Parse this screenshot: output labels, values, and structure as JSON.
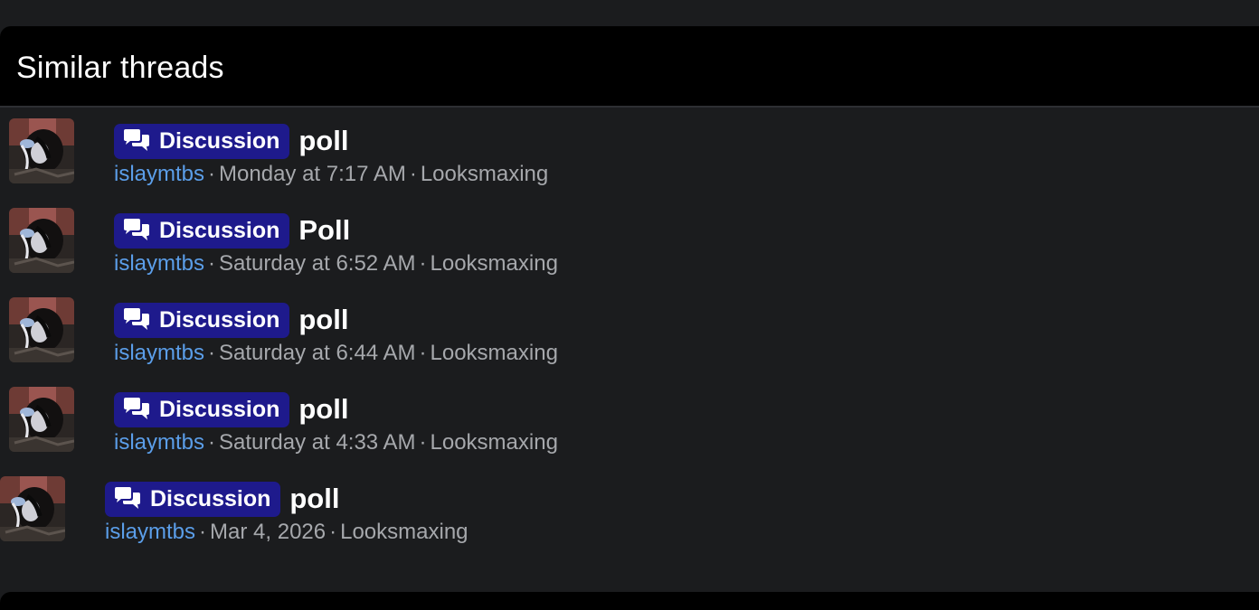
{
  "section": {
    "title": "Similar threads"
  },
  "icons": {
    "badge_icon": "speech-bubbles-icon",
    "avatar": "user-avatar"
  },
  "colors": {
    "background": "#1b1c1e",
    "header_background": "#000000",
    "badge_background": "#1e1a8c",
    "author_link": "#5b9ee9",
    "meta_text": "#a6a8ac",
    "title_text": "#ffffff"
  },
  "threads": [
    {
      "prefix": "Discussion",
      "title": "poll",
      "author": "islaymtbs",
      "date": "Monday at 7:17 AM",
      "forum": "Looksmaxing"
    },
    {
      "prefix": "Discussion",
      "title": "Poll",
      "author": "islaymtbs",
      "date": "Saturday at 6:52 AM",
      "forum": "Looksmaxing"
    },
    {
      "prefix": "Discussion",
      "title": "poll",
      "author": "islaymtbs",
      "date": "Saturday at 6:44 AM",
      "forum": "Looksmaxing"
    },
    {
      "prefix": "Discussion",
      "title": "poll",
      "author": "islaymtbs",
      "date": "Saturday at 4:33 AM",
      "forum": "Looksmaxing"
    },
    {
      "prefix": "Discussion",
      "title": "poll",
      "author": "islaymtbs",
      "date": "Mar 4, 2026",
      "forum": "Looksmaxing"
    }
  ]
}
